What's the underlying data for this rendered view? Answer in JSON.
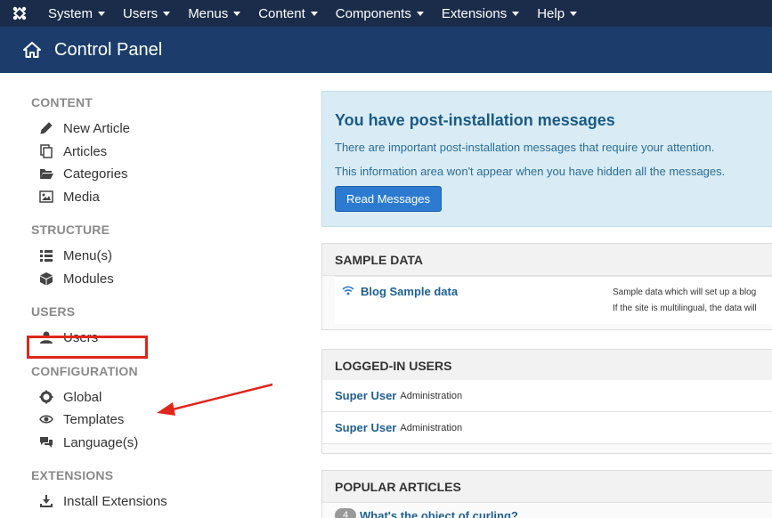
{
  "navbar": {
    "logo_icon": "joomla-icon",
    "menus": [
      {
        "label": "System"
      },
      {
        "label": "Users"
      },
      {
        "label": "Menus"
      },
      {
        "label": "Content"
      },
      {
        "label": "Components"
      },
      {
        "label": "Extensions"
      },
      {
        "label": "Help"
      }
    ]
  },
  "header": {
    "icon": "home-icon",
    "title": "Control Panel"
  },
  "sidebar": {
    "content": {
      "title": "CONTENT",
      "items": [
        {
          "label": "New Article",
          "icon": "pencil-icon"
        },
        {
          "label": "Articles",
          "icon": "copy-icon"
        },
        {
          "label": "Categories",
          "icon": "folder-open-icon"
        },
        {
          "label": "Media",
          "icon": "image-icon"
        }
      ]
    },
    "structure": {
      "title": "STRUCTURE",
      "items": [
        {
          "label": "Menu(s)",
          "icon": "list-icon"
        },
        {
          "label": "Modules",
          "icon": "cube-icon"
        }
      ]
    },
    "users": {
      "title": "USERS",
      "items": [
        {
          "label": "Users",
          "icon": "user-icon"
        }
      ]
    },
    "configuration": {
      "title": "CONFIGURATION",
      "items": [
        {
          "label": "Global",
          "icon": "cog-icon"
        },
        {
          "label": "Templates",
          "icon": "eye-icon"
        },
        {
          "label": "Language(s)",
          "icon": "comments-icon"
        }
      ]
    },
    "extensions": {
      "title": "EXTENSIONS",
      "items": [
        {
          "label": "Install Extensions",
          "icon": "download-icon"
        }
      ]
    }
  },
  "annotation": {
    "highlight_color": "#e0261c"
  },
  "alert": {
    "title": "You have post-installation messages",
    "line1": "There are important post-installation messages that require your attention.",
    "line2": "This information area won't appear when you have hidden all the messages.",
    "button": "Read Messages"
  },
  "sample_data": {
    "title": "SAMPLE DATA",
    "item_label": "Blog Sample data",
    "desc1": "Sample data which will set up a blog",
    "desc2": "If the site is multilingual, the data will"
  },
  "logged_in": {
    "title": "LOGGED-IN USERS",
    "rows": [
      {
        "user": "Super User",
        "role": "Administration"
      },
      {
        "user": "Super User",
        "role": "Administration"
      }
    ]
  },
  "popular": {
    "title": "POPULAR ARTICLES",
    "first_badge": "4",
    "first_title": "What's the object of curling?"
  },
  "colors": {
    "navbar_bg": "#1a2c49",
    "header_bg": "#1c3d6b",
    "alert_bg": "#d9ecf5",
    "link": "#1f5f92",
    "button": "#2d7bd0"
  }
}
